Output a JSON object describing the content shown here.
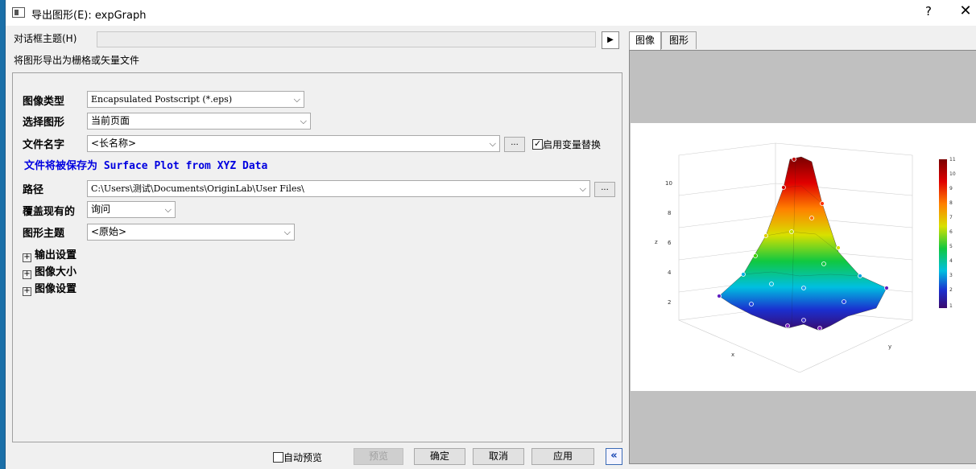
{
  "window": {
    "title": "导出图形(E): expGraph",
    "help": "?",
    "close": "✕"
  },
  "theme": {
    "label": "对话框主题(H)",
    "value": ""
  },
  "description": "将图形导出为栅格或矢量文件",
  "form": {
    "image_type": {
      "label": "图像类型",
      "value": "Encapsulated Postscript (*.eps)"
    },
    "select_graph": {
      "label": "选择图形",
      "value": "当前页面"
    },
    "file_name": {
      "label": "文件名字",
      "value": "<长名称>",
      "browse": "...",
      "var_replace_label": "启用变量替换",
      "var_replace_checked": true
    },
    "save_as_text": "文件将被保存为 Surface Plot from XYZ Data",
    "path": {
      "label": "路径",
      "value": "C:\\Users\\测试\\Documents\\OriginLab\\User Files\\",
      "browse": "..."
    },
    "overwrite": {
      "label": "覆盖现有的",
      "value": "询问"
    },
    "graph_theme": {
      "label": "图形主题",
      "value": "<原始>"
    },
    "sections": [
      "输出设置",
      "图像大小",
      "图像设置"
    ]
  },
  "footer": {
    "auto_preview_label": "自动预览",
    "auto_preview_checked": false,
    "preview": "预览",
    "ok": "确定",
    "cancel": "取消",
    "apply": "应用",
    "collapse": "«"
  },
  "tabs": [
    "图像",
    "图形"
  ],
  "active_tab": 0,
  "plot": {
    "z_label": "z",
    "x_label": "x",
    "y_label": "y",
    "z_ticks": [
      "2",
      "4",
      "6",
      "8",
      "10"
    ],
    "colorbar_ticks": [
      "11",
      "10",
      "9",
      "8",
      "7",
      "6",
      "5",
      "4",
      "3",
      "2",
      "1"
    ]
  }
}
